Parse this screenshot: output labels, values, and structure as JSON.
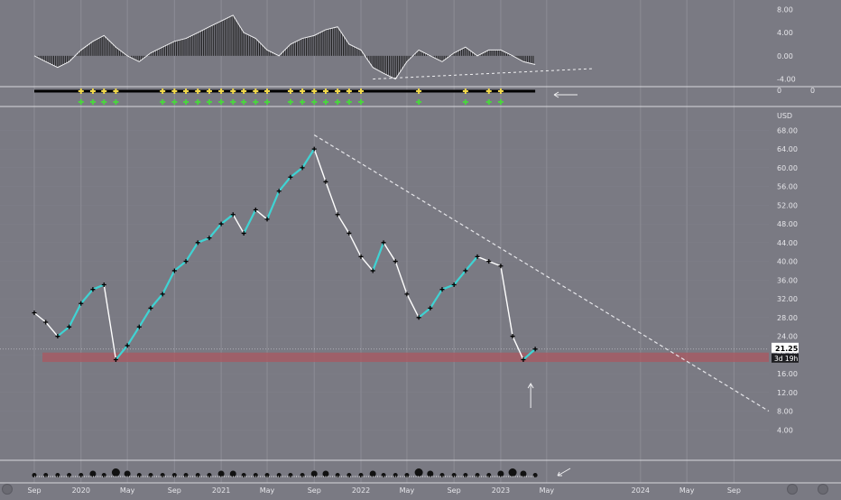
{
  "theme": {
    "background": "#7a7a83",
    "grid": "#8c8c95",
    "axis_text": "#e6e6ea",
    "price_line": "#ffffff",
    "trend_segment": "#3fd3d3",
    "marker": "#000000",
    "support_zone": "#a85a63",
    "trendline": "#e6e6ea",
    "histogram": "#1c1c1c",
    "yellow_signal": "#f2d94a",
    "green_signal": "#4bd43f",
    "label_bg_price": "#ffffff",
    "label_bg_timer": "#ffffff"
  },
  "price_axis": {
    "currency": "USD",
    "ticks": [
      "68.00",
      "64.00",
      "60.00",
      "56.00",
      "52.00",
      "48.00",
      "44.00",
      "40.00",
      "36.00",
      "32.00",
      "28.00",
      "24.00",
      "20.00",
      "16.00",
      "12.00",
      "8.00",
      "4.00"
    ],
    "current_price": "21.25",
    "countdown": "3d 19h"
  },
  "oscillator_axis": {
    "ticks": [
      "8.00",
      "4.00",
      "0.00",
      "-4.00"
    ]
  },
  "signal_axis": {
    "ticks": [
      "0",
      "0"
    ]
  },
  "time_axis": {
    "ticks": [
      "Sep",
      "2020",
      "May",
      "Sep",
      "2021",
      "May",
      "Sep",
      "2022",
      "May",
      "Sep",
      "2023",
      "May",
      "2024",
      "May",
      "Sep"
    ]
  },
  "chart_data": {
    "type": "line",
    "title": "",
    "ylabel": "USD",
    "ylim": [
      0,
      70
    ],
    "x": [
      "2019-09",
      "2019-10",
      "2019-11",
      "2019-12",
      "2020-01",
      "2020-02",
      "2020-03",
      "2020-04",
      "2020-05",
      "2020-06",
      "2020-07",
      "2020-08",
      "2020-09",
      "2020-10",
      "2020-11",
      "2020-12",
      "2021-01",
      "2021-02",
      "2021-03",
      "2021-04",
      "2021-05",
      "2021-06",
      "2021-07",
      "2021-08",
      "2021-09",
      "2021-10",
      "2021-11",
      "2021-12",
      "2022-01",
      "2022-02",
      "2022-03",
      "2022-04",
      "2022-05",
      "2022-06",
      "2022-07",
      "2022-08",
      "2022-09",
      "2022-10",
      "2022-11",
      "2022-12",
      "2023-01",
      "2023-02",
      "2023-03",
      "2023-04"
    ],
    "series": [
      {
        "values": [
          29,
          27,
          24,
          26,
          31,
          34,
          35,
          19,
          22,
          26,
          30,
          33,
          38,
          40,
          44,
          45,
          48,
          50,
          46,
          51,
          49,
          55,
          58,
          60,
          64,
          57,
          50,
          46,
          41,
          38,
          44,
          40,
          33,
          28,
          30,
          34,
          35,
          38,
          41,
          40,
          39,
          24,
          19,
          21.25
        ]
      }
    ],
    "support_zone": [
      18.5,
      20.5
    ],
    "trendline": {
      "start": {
        "x": "2021-09",
        "y": 67
      },
      "end": {
        "x": "2024-12",
        "y": 8
      }
    },
    "oscillator": {
      "ylim": [
        -5,
        9
      ],
      "values": [
        0,
        -1,
        -2,
        -1,
        1,
        2.5,
        3.5,
        1.5,
        0,
        -1,
        0.5,
        1.5,
        2.5,
        3,
        4,
        5,
        6,
        7,
        4,
        3,
        1,
        0,
        2,
        3,
        3.5,
        4.5,
        5,
        2,
        1,
        -2,
        -3,
        -4,
        -1,
        1,
        0,
        -1,
        0.5,
        1.5,
        0,
        1,
        1,
        0,
        -1,
        -1.5
      ]
    },
    "volume": {
      "values": [
        1,
        1,
        1,
        1,
        1,
        2,
        1,
        3,
        2,
        1,
        1,
        1,
        1,
        1,
        1,
        1,
        2,
        2,
        1,
        1,
        1,
        1,
        1,
        1,
        2,
        2,
        1,
        1,
        1,
        2,
        1,
        1,
        1,
        3,
        2,
        1,
        1,
        1,
        1,
        1,
        2,
        3,
        2,
        1
      ]
    }
  }
}
